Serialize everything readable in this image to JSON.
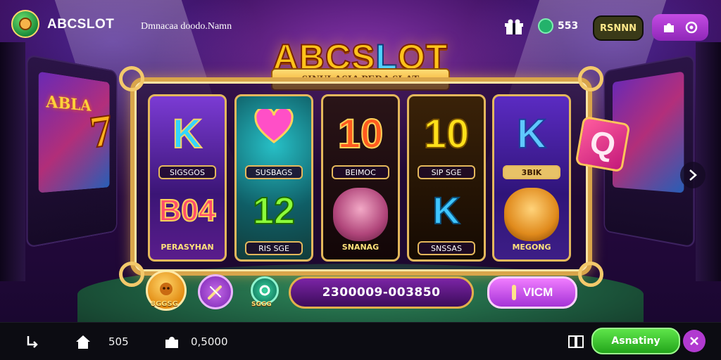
{
  "header": {
    "brand": "ABCSLOT",
    "domain": "Dmnacaa doodo.Namn",
    "coin_value": "553",
    "login_label": "RSNNN"
  },
  "title": {
    "main_a": "ABCS",
    "main_o": "L",
    "main_b": "OT",
    "subtitle": "SINULASIA PERA SLAT"
  },
  "side_cabinet_left_text": "ABLA",
  "side_seven": "7",
  "side_q": "Q",
  "reels": [
    {
      "top_symbol": "K",
      "top_label": "SIGSGOS",
      "bottom_symbol": "B04",
      "bottom_label": "PERASYHAN"
    },
    {
      "top_symbol": "heart",
      "top_label": "SUSBAGS",
      "bottom_symbol": "12",
      "bottom_label": "RIS SGE"
    },
    {
      "top_symbol": "10",
      "top_label": "BEIMOC",
      "bottom_symbol": "tiger",
      "bottom_label": "SNANAG"
    },
    {
      "top_symbol": "10",
      "top_label": "SIP SGE",
      "bottom_symbol": "K",
      "bottom_label": "SNSSAS"
    },
    {
      "top_symbol": "K",
      "top_label": "3BIK",
      "bottom_symbol": "lion",
      "bottom_label": "MEGONG"
    }
  ],
  "controls": {
    "coin_label": "8GGSG",
    "small_label": "SGGG",
    "win_value": "2300009-003850",
    "spin_label": "VICM"
  },
  "bottombar": {
    "home_value": "505",
    "bonus_value": "0,5000",
    "action_label": "Asnatiny"
  },
  "colors": {
    "accent_gold": "#e4b85c",
    "accent_purple": "#a533d6",
    "accent_green": "#23a51b"
  }
}
